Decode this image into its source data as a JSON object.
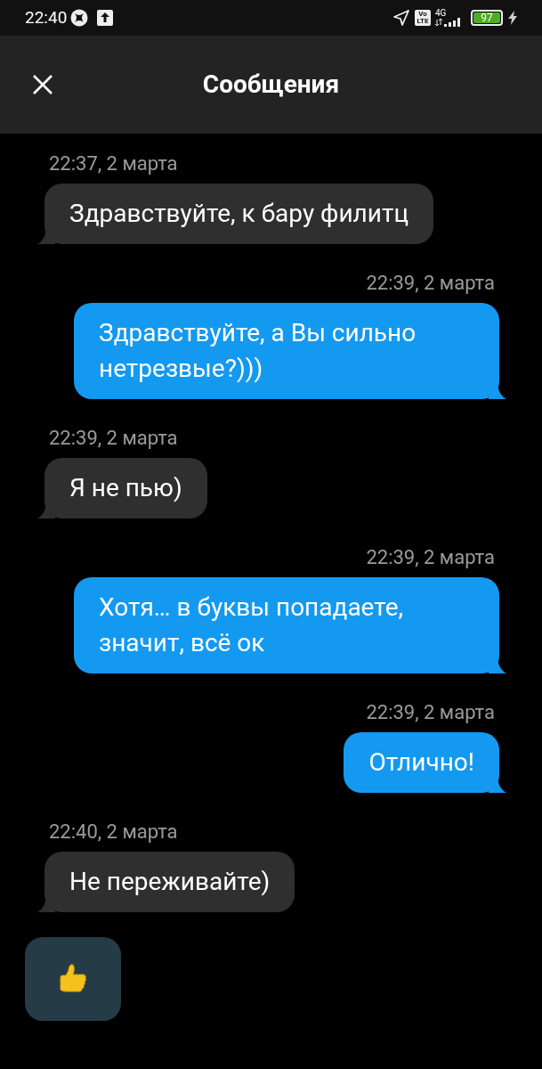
{
  "status_bar": {
    "time": "22:40",
    "volte": [
      "Vo",
      "LTE"
    ],
    "network": "4G",
    "battery": "97"
  },
  "header": {
    "title": "Сообщения"
  },
  "messages": [
    {
      "kind": "incoming",
      "time": "22:37, 2 марта",
      "text": "Здравствуйте, к бару филитц"
    },
    {
      "kind": "outgoing",
      "time": "22:39, 2 марта",
      "text": "Здравствуйте, а Вы сильно нетрезвые?)))"
    },
    {
      "kind": "incoming",
      "time": "22:39, 2 марта",
      "text": "Я не пью)"
    },
    {
      "kind": "outgoing",
      "time": "22:39, 2 марта",
      "text": "Хотя… в буквы попадаете, значит, всё ок"
    },
    {
      "kind": "outgoing",
      "time": "22:39, 2 марта",
      "text": "Отлично!"
    },
    {
      "kind": "incoming",
      "time": "22:40, 2 марта",
      "text": "Не переживайте)"
    }
  ]
}
